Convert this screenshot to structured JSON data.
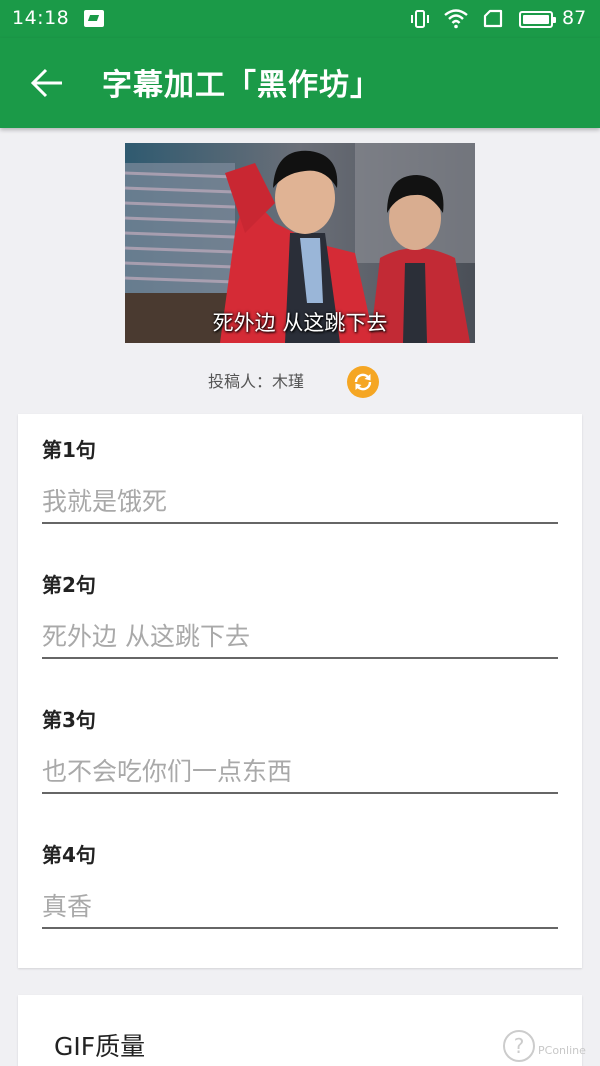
{
  "status_bar": {
    "time": "14:18",
    "battery_level": "87",
    "icons": [
      "image-notification-icon",
      "vibrate-icon",
      "wifi-icon",
      "sim-icon",
      "battery-icon"
    ]
  },
  "app_bar": {
    "back_icon": "arrow-left-icon",
    "title": "字幕加工「黑作坊」"
  },
  "preview": {
    "caption": "死外边 从这跳下去"
  },
  "contributor": {
    "label": "投稿人：木瑾",
    "refresh_icon": "refresh-icon"
  },
  "subtitles": [
    {
      "label": "第1句",
      "placeholder": "我就是饿死"
    },
    {
      "label": "第2句",
      "placeholder": "死外边 从这跳下去"
    },
    {
      "label": "第3句",
      "placeholder": "也不会吃你们一点东西"
    },
    {
      "label": "第4句",
      "placeholder": "真香"
    }
  ],
  "quality": {
    "label": "GIF质量"
  },
  "help_icon": "help-icon",
  "watermark": "PConline",
  "colors": {
    "primary": "#1b9a48",
    "accent": "#f5a623",
    "background": "#f0f0f3"
  }
}
